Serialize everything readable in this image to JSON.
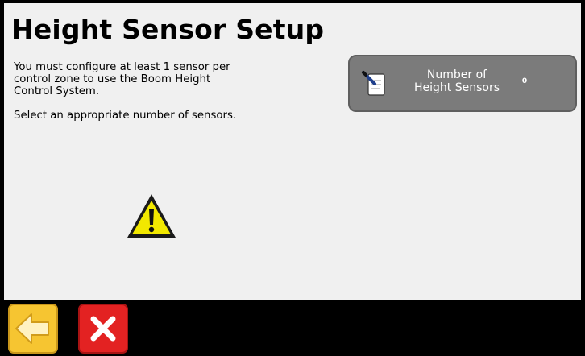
{
  "header": {
    "title": "Height Sensor Setup"
  },
  "message": {
    "lines": [
      "You must configure at least 1 sensor per",
      "control zone to use the Boom Height",
      "Control System."
    ],
    "instruction": "Select an appropriate number of sensors."
  },
  "sensor_setting": {
    "label_line1": "Number of",
    "label_line2": "Height Sensors",
    "value": "0",
    "icon": "edit-notepad-icon"
  },
  "warning": {
    "icon": "warning-triangle-icon",
    "color": "#f2e800"
  },
  "footer": {
    "back_icon": "back-arrow-icon",
    "back_color": "#f6c531",
    "cancel_icon": "cancel-x-icon",
    "cancel_color": "#e32222"
  }
}
